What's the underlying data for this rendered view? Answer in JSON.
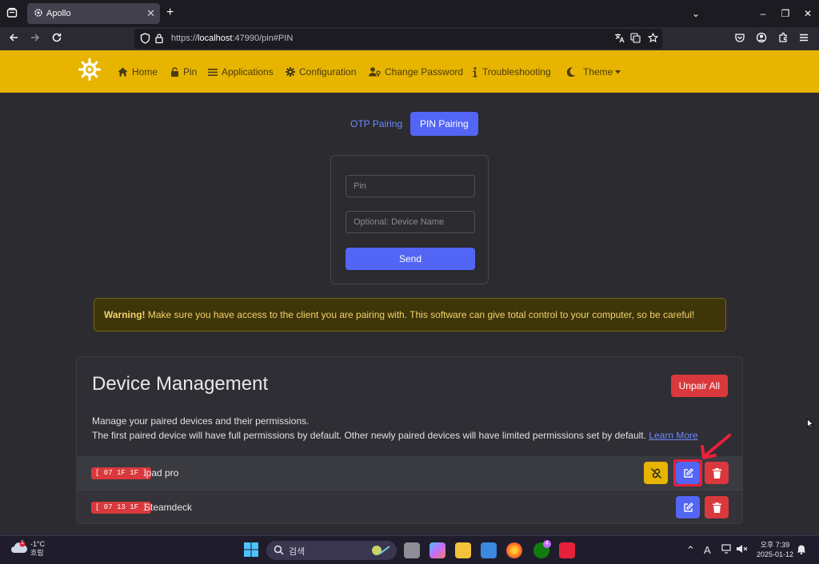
{
  "browser": {
    "tab_title": "Apollo",
    "url_prefix": "https://",
    "url_host": "localhost",
    "url_rest": ":47990/pin#PIN",
    "tab_close": "✕",
    "new_tab": "+"
  },
  "nav": {
    "items": [
      {
        "label": "Home",
        "icon": "home-icon"
      },
      {
        "label": "Pin",
        "icon": "lock-icon"
      },
      {
        "label": "Applications",
        "icon": "list-icon"
      },
      {
        "label": "Configuration",
        "icon": "gear-icon"
      },
      {
        "label": "Change Password",
        "icon": "user-key-icon"
      },
      {
        "label": "Troubleshooting",
        "icon": "info-icon"
      },
      {
        "label": "Theme",
        "icon": "moon-icon"
      }
    ]
  },
  "pairing": {
    "tab_otp": "OTP Pairing",
    "tab_pin": "PIN Pairing",
    "pin_placeholder": "Pin",
    "device_name_placeholder": "Optional: Device Name",
    "send_label": "Send"
  },
  "warning": {
    "strong": "Warning!",
    "text": " Make sure you have access to the client you are pairing with. This software can give total control to your computer, so be careful!"
  },
  "device_management": {
    "title": "Device Management",
    "unpair_all_label": "Unpair All",
    "desc_line1": "Manage your paired devices and their permissions.",
    "desc_line2": "The first paired device will have full permissions by default. Other newly paired devices will have limited permissions set by default. ",
    "learn_more": "Learn More",
    "devices": [
      {
        "badge": "[ 07 1F 1F ]",
        "name": "ipad pro"
      },
      {
        "badge": "[ 07 13 1F ]",
        "name": "Steamdeck"
      }
    ]
  },
  "taskbar": {
    "temperature": "-1°C",
    "weather_desc": "흐림",
    "weather_badge": "1",
    "search_placeholder": "검색",
    "xbox_badge": "4",
    "clock_time": "오후 7:39",
    "clock_date": "2025-01-12",
    "ime": "A"
  },
  "colors": {
    "accent_yellow": "#e7b400",
    "primary_blue": "#5265f5",
    "danger_red": "#d9393c"
  }
}
